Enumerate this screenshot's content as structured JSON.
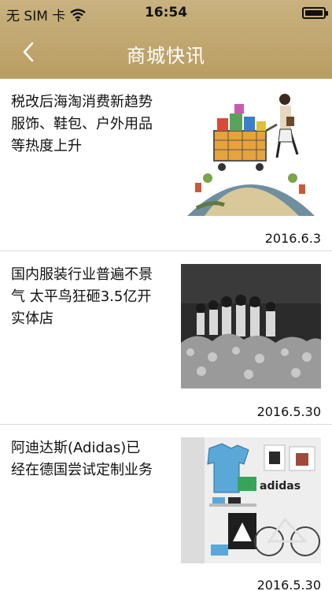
{
  "status_bar": {
    "carrier": "无 SIM 卡",
    "time": "16:54",
    "wifi_icon": "wifi-icon",
    "battery_icon": "battery-icon"
  },
  "nav": {
    "back_icon": "chevron-left-icon",
    "title": "商城快讯"
  },
  "articles": [
    {
      "title": "税改后海淘消费新趋势 服饰、鞋包、户外用品等热度上升",
      "date": "2016.6.3",
      "thumb_icon": "shopping-globe-illustration"
    },
    {
      "title": "国内服装行业普遍不景气 太平鸟狂砸3.5亿开实体店",
      "date": "2016.5.30",
      "thumb_icon": "fashion-show-photo"
    },
    {
      "title": "阿迪达斯(Adidas)已经在德国尝试定制业务",
      "date": "2016.5.30",
      "thumb_icon": "adidas-store-photo"
    }
  ],
  "colors": {
    "nav_gold": "#c2a870",
    "nav_title": "#ffffff",
    "divider": "#d9d9d9"
  }
}
